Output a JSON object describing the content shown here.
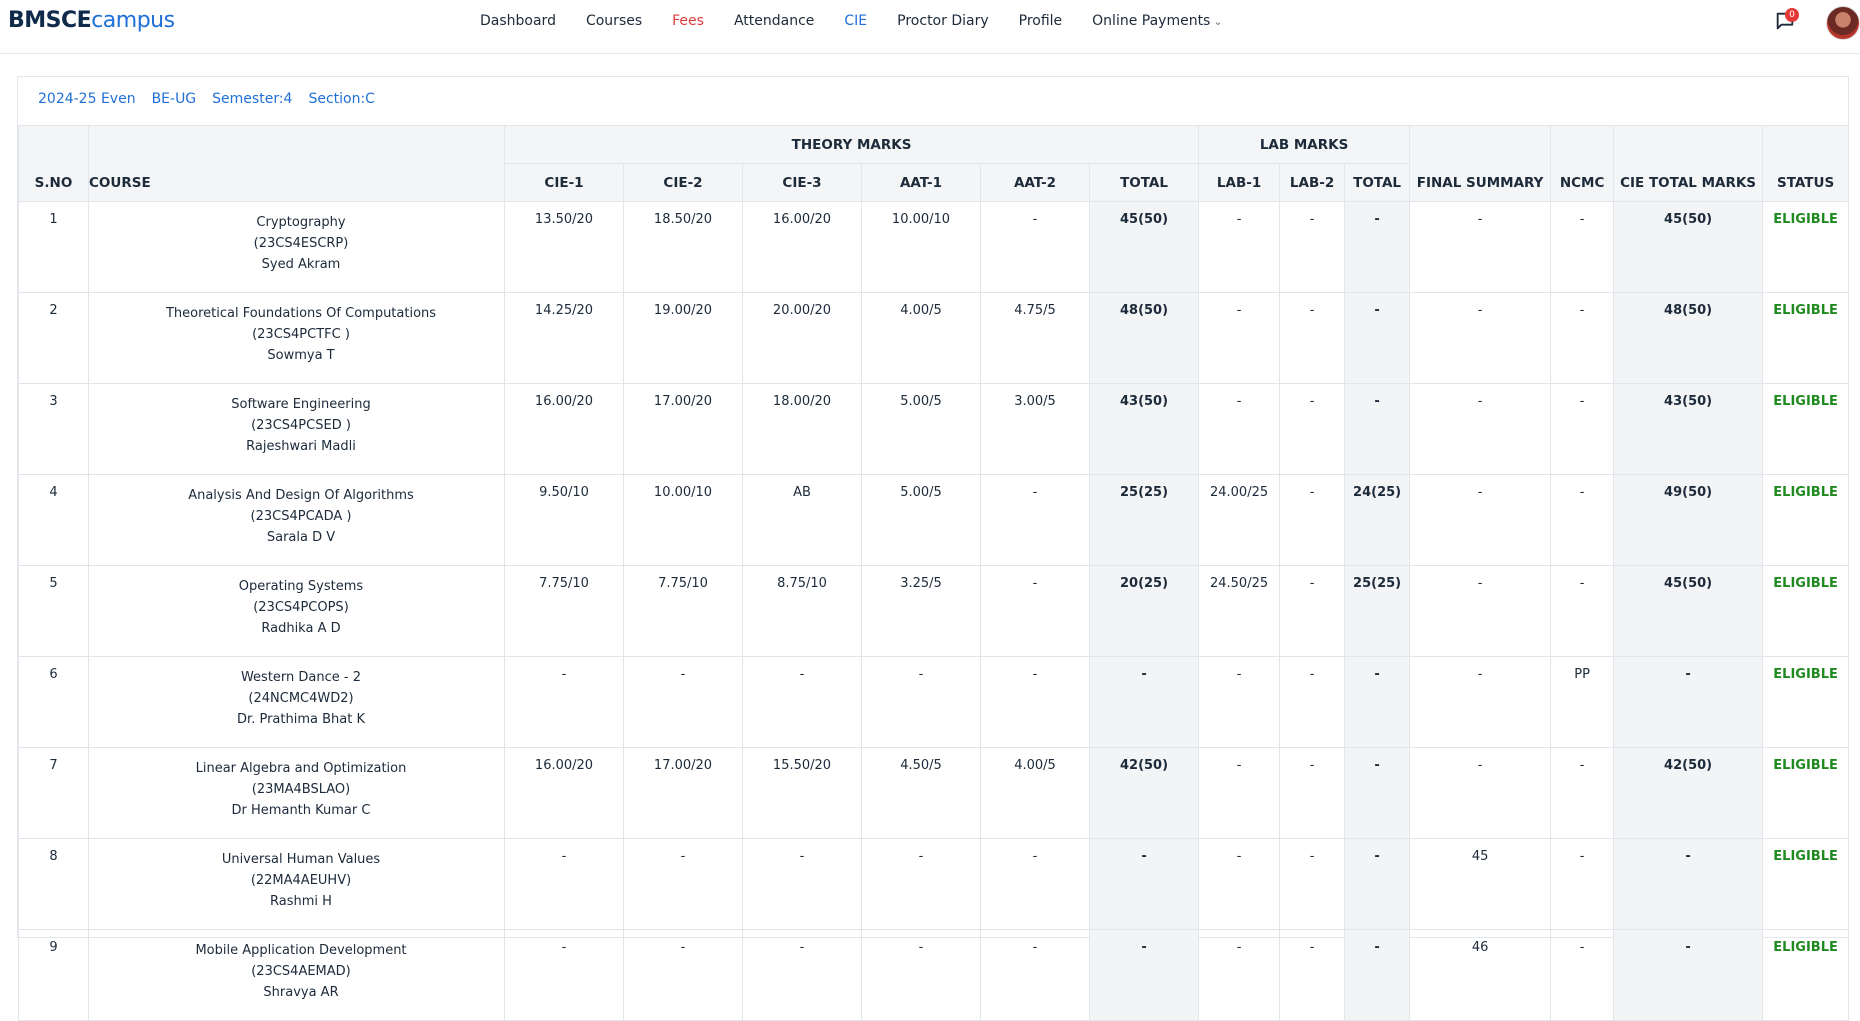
{
  "brand": {
    "part1": "BMSCE",
    "part2": "campus"
  },
  "nav": [
    {
      "label": "Dashboard"
    },
    {
      "label": "Courses"
    },
    {
      "label": "Fees"
    },
    {
      "label": "Attendance"
    },
    {
      "label": "CIE"
    },
    {
      "label": "Proctor Diary"
    },
    {
      "label": "Profile"
    },
    {
      "label": "Online Payments"
    }
  ],
  "notifications": {
    "count": "0"
  },
  "colors": {
    "accent": "#1f6fd6",
    "fees": "#e03b3b",
    "eligible": "#1f8a1f",
    "badge": "#e53935"
  },
  "filters": {
    "year": "2024-25 Even",
    "program": "BE-UG",
    "semester": "Semester:4",
    "section": "Section:C"
  },
  "headers": {
    "sno": "S.NO",
    "course": "COURSE",
    "theory": "THEORY MARKS",
    "lab": "LAB MARKS",
    "cie1": "CIE-1",
    "cie2": "CIE-2",
    "cie3": "CIE-3",
    "aat1": "AAT-1",
    "aat2": "AAT-2",
    "total": "TOTAL",
    "lab1": "LAB-1",
    "lab2": "LAB-2",
    "labtotal": "TOTAL",
    "final": "FINAL SUMMARY",
    "ncmc": "NCMC",
    "cietotal": "CIE TOTAL MARKS",
    "status": "STATUS"
  },
  "rows": [
    {
      "sno": "1",
      "name": "Cryptography",
      "code": "(23CS4ESCRP)",
      "teacher": "Syed Akram",
      "cie1": "13.50/20",
      "cie2": "18.50/20",
      "cie3": "16.00/20",
      "aat1": "10.00/10",
      "aat2": "-",
      "total": "45(50)",
      "lab1": "-",
      "lab2": "-",
      "labtotal": "-",
      "final": "-",
      "ncmc": "-",
      "cietotal": "45(50)",
      "status": "ELIGIBLE"
    },
    {
      "sno": "2",
      "name": "Theoretical Foundations Of Computations",
      "code": "(23CS4PCTFC )",
      "teacher": "Sowmya T",
      "cie1": "14.25/20",
      "cie2": "19.00/20",
      "cie3": "20.00/20",
      "aat1": "4.00/5",
      "aat2": "4.75/5",
      "total": "48(50)",
      "lab1": "-",
      "lab2": "-",
      "labtotal": "-",
      "final": "-",
      "ncmc": "-",
      "cietotal": "48(50)",
      "status": "ELIGIBLE"
    },
    {
      "sno": "3",
      "name": "Software Engineering",
      "code": "(23CS4PCSED )",
      "teacher": "Rajeshwari Madli",
      "cie1": "16.00/20",
      "cie2": "17.00/20",
      "cie3": "18.00/20",
      "aat1": "5.00/5",
      "aat2": "3.00/5",
      "total": "43(50)",
      "lab1": "-",
      "lab2": "-",
      "labtotal": "-",
      "final": "-",
      "ncmc": "-",
      "cietotal": "43(50)",
      "status": "ELIGIBLE"
    },
    {
      "sno": "4",
      "name": "Analysis And Design Of Algorithms",
      "code": "(23CS4PCADA )",
      "teacher": "Sarala D V",
      "cie1": "9.50/10",
      "cie2": "10.00/10",
      "cie3": "AB",
      "aat1": "5.00/5",
      "aat2": "-",
      "total": "25(25)",
      "lab1": "24.00/25",
      "lab2": "-",
      "labtotal": "24(25)",
      "final": "-",
      "ncmc": "-",
      "cietotal": "49(50)",
      "status": "ELIGIBLE"
    },
    {
      "sno": "5",
      "name": "Operating Systems",
      "code": "(23CS4PCOPS)",
      "teacher": "Radhika A D",
      "cie1": "7.75/10",
      "cie2": "7.75/10",
      "cie3": "8.75/10",
      "aat1": "3.25/5",
      "aat2": "-",
      "total": "20(25)",
      "lab1": "24.50/25",
      "lab2": "-",
      "labtotal": "25(25)",
      "final": "-",
      "ncmc": "-",
      "cietotal": "45(50)",
      "status": "ELIGIBLE"
    },
    {
      "sno": "6",
      "name": "Western Dance - 2",
      "code": "(24NCMC4WD2)",
      "teacher": "Dr. Prathima Bhat K",
      "cie1": "-",
      "cie2": "-",
      "cie3": "-",
      "aat1": "-",
      "aat2": "-",
      "total": "-",
      "lab1": "-",
      "lab2": "-",
      "labtotal": "-",
      "final": "-",
      "ncmc": "PP",
      "cietotal": "-",
      "status": "ELIGIBLE"
    },
    {
      "sno": "7",
      "name": "Linear Algebra and Optimization",
      "code": "(23MA4BSLAO)",
      "teacher": "Dr Hemanth Kumar C",
      "cie1": "16.00/20",
      "cie2": "17.00/20",
      "cie3": "15.50/20",
      "aat1": "4.50/5",
      "aat2": "4.00/5",
      "total": "42(50)",
      "lab1": "-",
      "lab2": "-",
      "labtotal": "-",
      "final": "-",
      "ncmc": "-",
      "cietotal": "42(50)",
      "status": "ELIGIBLE"
    },
    {
      "sno": "8",
      "name": "Universal Human Values",
      "code": "(22MA4AEUHV)",
      "teacher": "Rashmi H",
      "cie1": "-",
      "cie2": "-",
      "cie3": "-",
      "aat1": "-",
      "aat2": "-",
      "total": "-",
      "lab1": "-",
      "lab2": "-",
      "labtotal": "-",
      "final": "45",
      "ncmc": "-",
      "cietotal": "-",
      "status": "ELIGIBLE"
    },
    {
      "sno": "9",
      "name": "Mobile Application Development",
      "code": "(23CS4AEMAD)",
      "teacher": "Shravya AR",
      "cie1": "-",
      "cie2": "-",
      "cie3": "-",
      "aat1": "-",
      "aat2": "-",
      "total": "-",
      "lab1": "-",
      "lab2": "-",
      "labtotal": "-",
      "final": "46",
      "ncmc": "-",
      "cietotal": "-",
      "status": "ELIGIBLE"
    }
  ]
}
